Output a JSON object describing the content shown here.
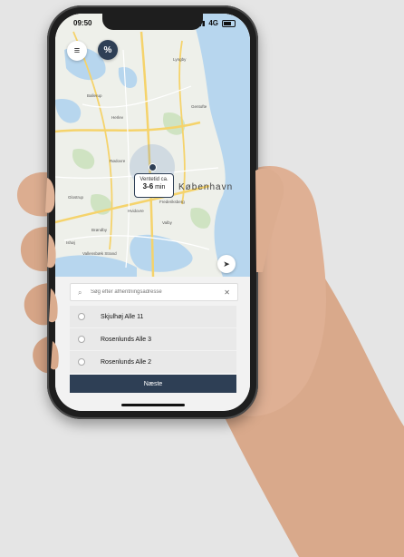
{
  "status_bar": {
    "time": "09:50",
    "network": "4G"
  },
  "map": {
    "wait_line1": "Ventetid ca.",
    "wait_value": "3-6",
    "wait_unit": "min",
    "city": "København",
    "labels": [
      "Ballerup",
      "Herlev",
      "Gentofte",
      "Lyngby",
      "Brøndby",
      "Valby",
      "Hvidovre",
      "Glostrup",
      "Rødovre",
      "Vallensbæk Strand",
      "Ishøj",
      "Frederiksberg"
    ]
  },
  "search": {
    "placeholder": "Søg efter afhentningsadresse"
  },
  "addresses": [
    "Skjulhøj Alle 11",
    "Rosenlunds Alle 3",
    "Rosenlunds Alle 2"
  ],
  "next_label": "Næste",
  "colors": {
    "accent": "#2e3f55",
    "water": "#b7d6ee",
    "park": "#cfe3c2",
    "road_major": "#f5d36b"
  }
}
